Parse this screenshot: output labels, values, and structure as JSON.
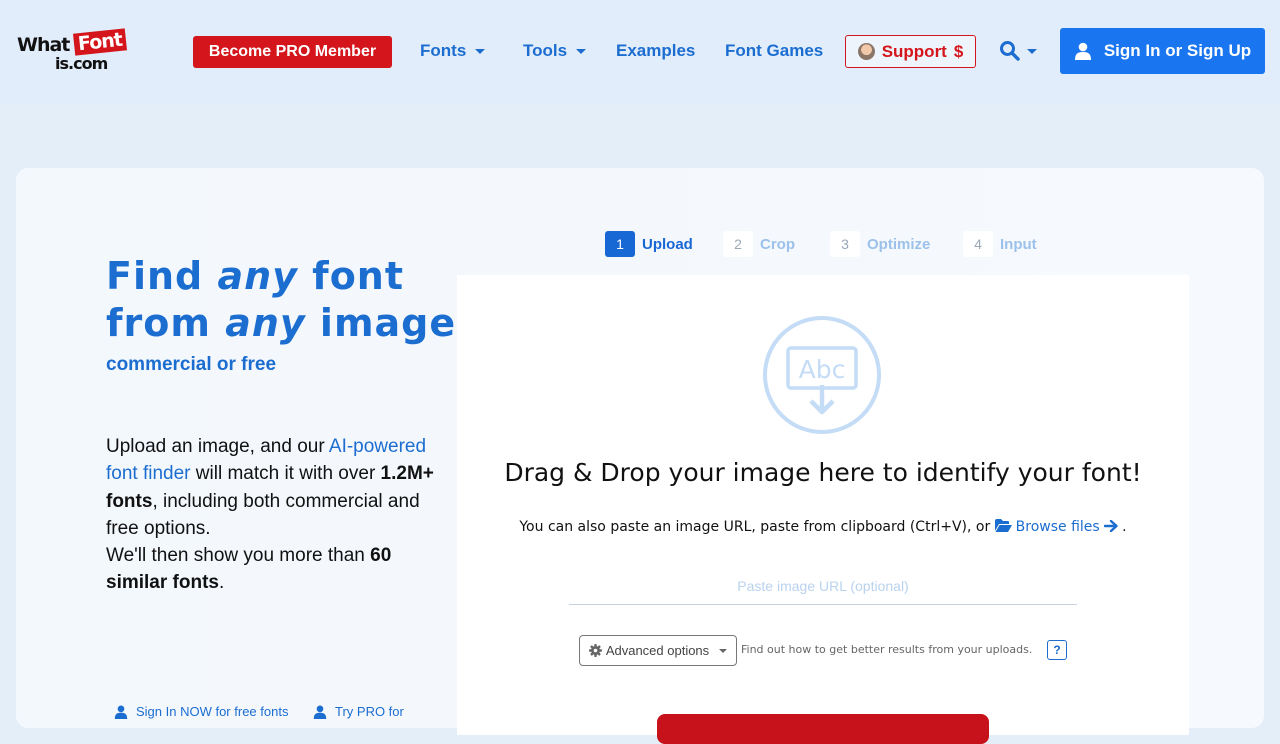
{
  "header": {
    "logo": {
      "what": "What",
      "font": "Font",
      "is": "is.com"
    },
    "pro_button": "Become PRO Member",
    "nav": {
      "fonts": "Fonts",
      "tools": "Tools",
      "examples": "Examples",
      "font_games": "Font Games"
    },
    "support": {
      "label": "Support",
      "symbol": "$"
    },
    "signin": "Sign In or Sign Up"
  },
  "hero": {
    "line1_a": "Find ",
    "line1_i": "any",
    "line1_b": " font",
    "line2_a": "from ",
    "line2_i": "any",
    "line2_b": " image",
    "subtitle": "commercial or free"
  },
  "description": {
    "p1": "Upload an image, and our ",
    "link": "AI-powered font finder",
    "p2": " will match it with over ",
    "bold1": "1.2M+ fonts",
    "p3": ", including both commercial and free options.",
    "p4": "We'll then show you more than ",
    "bold2": "60 similar fonts",
    "p5": "."
  },
  "bottom_links": {
    "signin_now": "Sign In NOW for free fonts",
    "try_pro": "Try PRO for"
  },
  "steps": [
    {
      "num": "1",
      "label": "Upload",
      "active": true
    },
    {
      "num": "2",
      "label": "Crop",
      "active": false
    },
    {
      "num": "3",
      "label": "Optimize",
      "active": false
    },
    {
      "num": "4",
      "label": "Input",
      "active": false
    }
  ],
  "upload": {
    "icon_text": "Abc",
    "title": "Drag & Drop your image here to identify your font!",
    "paste_text": "You can also paste an image URL, paste from clipboard (Ctrl+V), or ",
    "browse": "Browse files",
    "paste_end": " .",
    "url_placeholder": "Paste image URL (optional)",
    "advanced": "Advanced options",
    "hint": "Find out how to get better results from your uploads.",
    "help": "?"
  },
  "colors": {
    "brand_blue": "#1c6dd0",
    "brand_red": "#d4161c",
    "signin_blue": "#1976f0"
  },
  "icons": [
    "user-icon",
    "search-icon",
    "abc-upload-icon",
    "folder-open-icon",
    "arrow-right-icon",
    "gear-icon"
  ]
}
